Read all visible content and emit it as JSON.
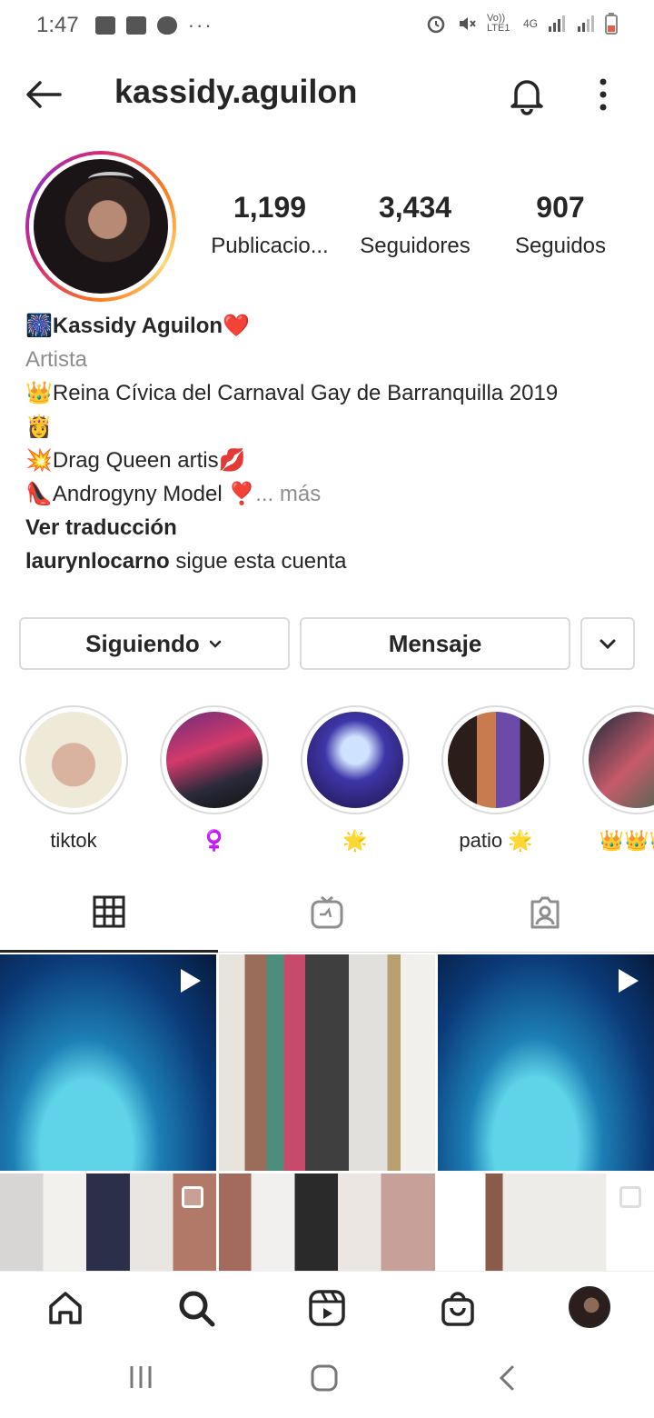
{
  "status_bar": {
    "time": "1:47",
    "dots": "···",
    "network_text": "Vo)) LTE1",
    "net_type": "4G"
  },
  "header": {
    "username": "kassidy.aguilon"
  },
  "profile": {
    "stats": [
      {
        "number": "1,199",
        "label": "Publicacio..."
      },
      {
        "number": "3,434",
        "label": "Seguidores"
      },
      {
        "number": "907",
        "label": "Seguidos"
      }
    ],
    "name": "🎆Kassidy Aguilon❤️",
    "category": "Artista",
    "bio_lines": [
      "👑Reina Cívica del  Carnaval Gay de Barranquilla 2019",
      "👸",
      "💥Drag Queen artis💋",
      "👠Androgyny Model ❣️"
    ],
    "more": "... más",
    "translate": "Ver traducción",
    "followed_by_user": "laurynlocarno",
    "followed_by_suffix": " sigue esta cuenta"
  },
  "actions": {
    "following_label": "Siguiendo",
    "message_label": "Mensaje"
  },
  "highlights": [
    {
      "label": "tiktok"
    },
    {
      "label": "♀️"
    },
    {
      "label": "🌟"
    },
    {
      "label": "patio 🌟"
    },
    {
      "label": "👑👑👑"
    }
  ],
  "tabs": [
    {
      "icon": "grid-icon"
    },
    {
      "icon": "igtv-icon"
    },
    {
      "icon": "tagged-icon"
    }
  ],
  "bottom_nav": [
    {
      "icon": "home-icon"
    },
    {
      "icon": "search-icon"
    },
    {
      "icon": "reels-icon"
    },
    {
      "icon": "shop-icon"
    },
    {
      "icon": "profile-avatar"
    }
  ]
}
